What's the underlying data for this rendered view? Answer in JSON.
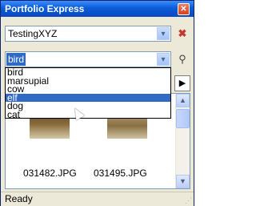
{
  "window": {
    "title": "Portfolio Express",
    "close_glyph": "✕"
  },
  "combo_portfolio": {
    "value": "TestingXYZ",
    "arrow_glyph": "▾"
  },
  "combo_keyword": {
    "value": "bird",
    "arrow_glyph": "▾"
  },
  "keyword_options": [
    "bird",
    "marsupial",
    "cow",
    "elf",
    "dog",
    "cat"
  ],
  "selected_option_index": 3,
  "tools": {
    "delete_icon": "✖",
    "search_icon": "⚲",
    "pager_next": "▶"
  },
  "thumbnails": [
    {
      "filename": "031482.JPG"
    },
    {
      "filename": "031495.JPG"
    }
  ],
  "scrollbar": {
    "up": "▲",
    "down": "▼"
  },
  "status": {
    "text": "Ready",
    "grip": "⋰"
  },
  "colors": {
    "title_bar": "#0a5cd8",
    "selection": "#316ac5",
    "face": "#ece9d8"
  }
}
